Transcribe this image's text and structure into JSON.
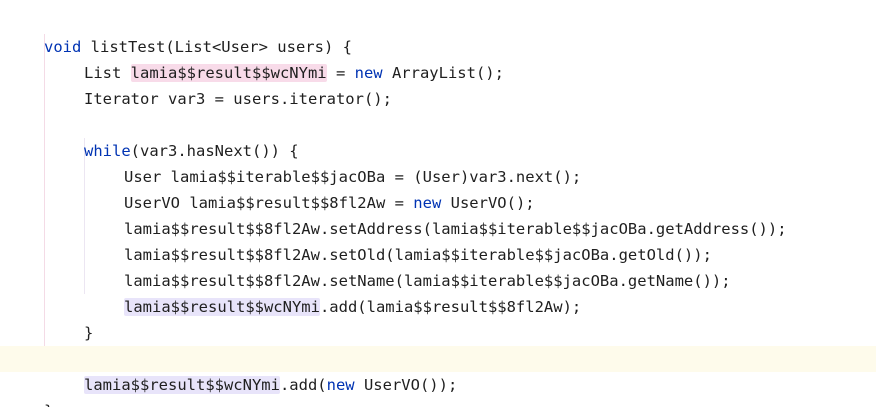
{
  "code": {
    "l1": {
      "kw": "void",
      "rest": " listTest(List<User> users) {"
    },
    "l2": {
      "a": "List ",
      "var": "lamia$$result$$wcNYmi",
      "b": " = ",
      "kw": "new",
      "c": " ArrayList();"
    },
    "l3": {
      "text": "Iterator var3 = users.iterator();"
    },
    "l5": {
      "kw": "while",
      "rest": "(var3.hasNext()) {"
    },
    "l6": {
      "text": "User lamia$$iterable$$jacOBa = (User)var3.next();"
    },
    "l7": {
      "a": "UserVO lamia$$result$$8fl2Aw = ",
      "kw": "new",
      "b": " UserVO();"
    },
    "l8": {
      "text": "lamia$$result$$8fl2Aw.setAddress(lamia$$iterable$$jacOBa.getAddress());"
    },
    "l9": {
      "text": "lamia$$result$$8fl2Aw.setOld(lamia$$iterable$$jacOBa.getOld());"
    },
    "l10": {
      "text": "lamia$$result$$8fl2Aw.setName(lamia$$iterable$$jacOBa.getName());"
    },
    "l11": {
      "var": "lamia$$result$$wcNYmi",
      "rest": ".add(lamia$$result$$8fl2Aw);"
    },
    "l12": {
      "text": "}"
    },
    "l14": {
      "var": "lamia$$result$$wcNYmi",
      "a": ".add(",
      "kw": "new",
      "b": " UserVO());"
    },
    "l15": {
      "text": "}"
    }
  },
  "colors": {
    "keyword": "#0033b3",
    "write_highlight": "#f8dbe9",
    "read_highlight": "#e8e4fa",
    "current_line": "#fefbeb"
  }
}
